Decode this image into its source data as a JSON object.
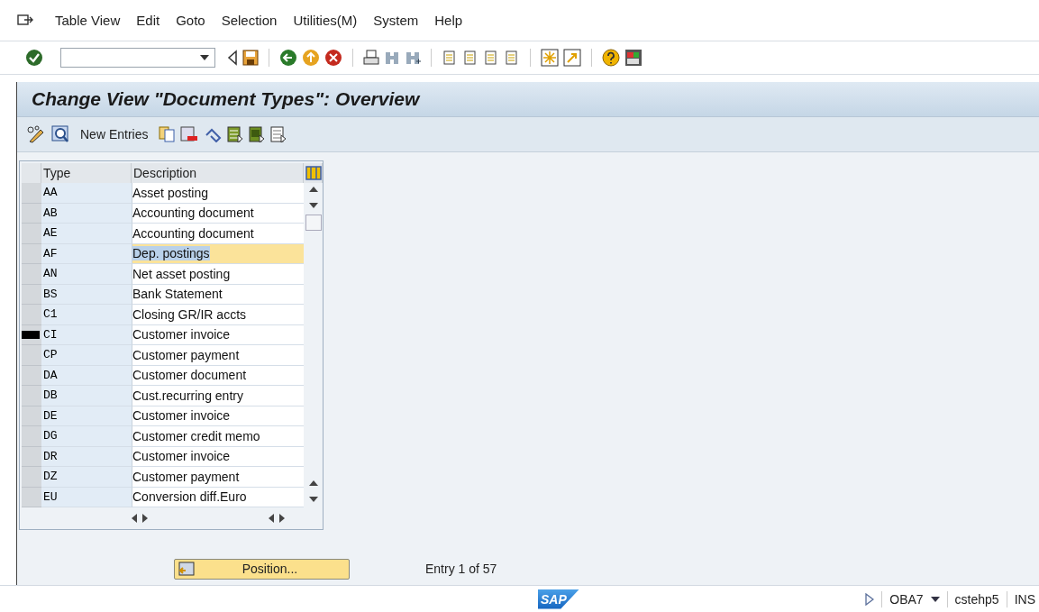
{
  "menu": [
    "Table View",
    "Edit",
    "Goto",
    "Selection",
    "Utilities(M)",
    "System",
    "Help"
  ],
  "title": "Change View \"Document Types\": Overview",
  "app_toolbar": {
    "new_entries": "New Entries"
  },
  "table": {
    "columns": [
      "Type",
      "Description"
    ],
    "rows": [
      {
        "type": "AA",
        "description": "Asset posting",
        "selected": false,
        "cursor": false
      },
      {
        "type": "AB",
        "description": "Accounting document",
        "selected": false,
        "cursor": false
      },
      {
        "type": "AE",
        "description": "Accounting document",
        "selected": false,
        "cursor": false
      },
      {
        "type": "AF",
        "description": "Dep. postings",
        "selected": true,
        "cursor": false
      },
      {
        "type": "AN",
        "description": "Net asset posting",
        "selected": false,
        "cursor": false
      },
      {
        "type": "BS",
        "description": "Bank Statement",
        "selected": false,
        "cursor": false
      },
      {
        "type": "C1",
        "description": "Closing GR/IR accts",
        "selected": false,
        "cursor": false
      },
      {
        "type": "CI",
        "description": "Customer invoice",
        "selected": false,
        "cursor": true
      },
      {
        "type": "CP",
        "description": "Customer payment",
        "selected": false,
        "cursor": false
      },
      {
        "type": "DA",
        "description": "Customer document",
        "selected": false,
        "cursor": false
      },
      {
        "type": "DB",
        "description": "Cust.recurring entry",
        "selected": false,
        "cursor": false
      },
      {
        "type": "DE",
        "description": "Customer invoice",
        "selected": false,
        "cursor": false
      },
      {
        "type": "DG",
        "description": "Customer credit memo",
        "selected": false,
        "cursor": false
      },
      {
        "type": "DR",
        "description": "Customer invoice",
        "selected": false,
        "cursor": false
      },
      {
        "type": "DZ",
        "description": "Customer payment",
        "selected": false,
        "cursor": false
      },
      {
        "type": "EU",
        "description": "Conversion diff.Euro",
        "selected": false,
        "cursor": false
      }
    ]
  },
  "position_button": "Position...",
  "entry_info": "Entry 1 of 57",
  "status_bar": {
    "logo": "SAP",
    "transaction": "OBA7",
    "system": "cstehp5",
    "mode": "INS"
  }
}
